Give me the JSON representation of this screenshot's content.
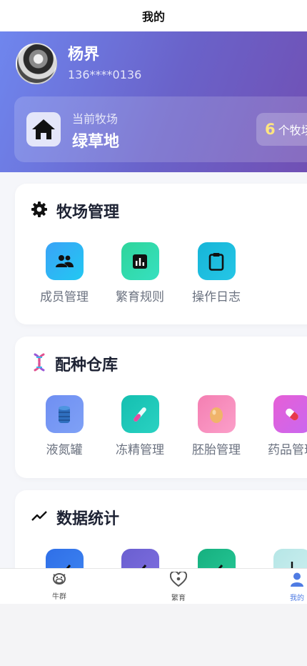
{
  "topbar": {
    "title": "我的"
  },
  "profile": {
    "name": "杨界",
    "phone": "136****0136"
  },
  "farm": {
    "label": "当前牧场",
    "name": "绿草地",
    "count": "6",
    "count_unit": "个牧场"
  },
  "sections": {
    "farm_management": {
      "title": "牧场管理",
      "items": [
        {
          "label": "成员管理"
        },
        {
          "label": "繁育规则"
        },
        {
          "label": "操作日志"
        }
      ]
    },
    "breeding_warehouse": {
      "title": "配种仓库",
      "items": [
        {
          "label": "液氮罐"
        },
        {
          "label": "冻精管理"
        },
        {
          "label": "胚胎管理"
        },
        {
          "label": "药品管理"
        }
      ]
    },
    "data_stats": {
      "title": "数据统计"
    }
  },
  "tabbar": {
    "items": [
      {
        "label": "牛群"
      },
      {
        "label": "繁育"
      },
      {
        "label": "我的"
      }
    ],
    "active_color": "#4f7be3"
  },
  "colors": {
    "hero_start": "#6f86ee",
    "hero_end": "#7150b4",
    "count_highlight": "#ffe57f"
  }
}
